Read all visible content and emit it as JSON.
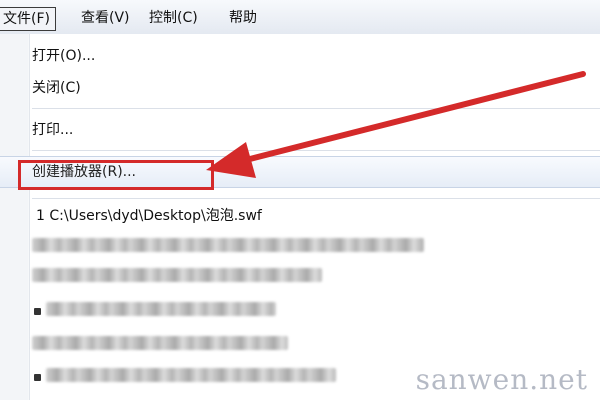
{
  "menubar": {
    "items": [
      {
        "label": "文件(F)",
        "active": true
      },
      {
        "label": "查看(V)"
      },
      {
        "label": "控制(C)"
      },
      {
        "label": "帮助"
      }
    ]
  },
  "file_menu": {
    "items": [
      {
        "label": "打开(O)..."
      },
      {
        "label": "关闭(C)"
      },
      {
        "label": "打印..."
      },
      {
        "label": "创建播放器(R)..."
      },
      {
        "label": "1 C:\\Users\\dyd\\Desktop\\泡泡.swf"
      }
    ]
  },
  "watermark": {
    "text": "sanwen.net"
  },
  "colors": {
    "annotation": "#d42a2a",
    "highlight": "#e6edf7"
  }
}
